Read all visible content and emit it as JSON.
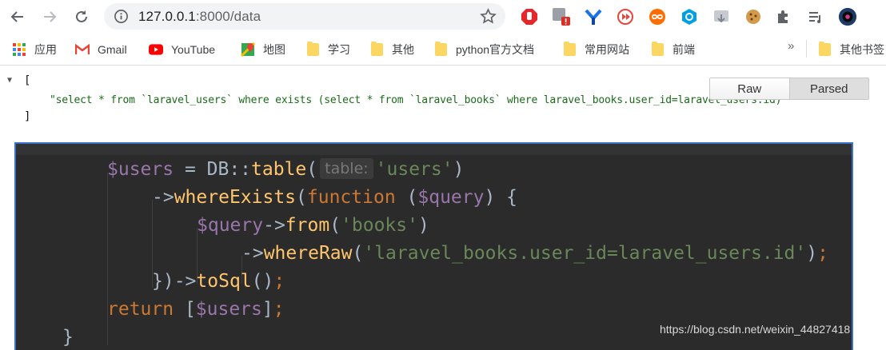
{
  "browser": {
    "url_host": "127.0.0.1",
    "url_rest": ":8000/data",
    "colors": {
      "omnibox_bg": "#f1f3f4",
      "icon": "#5f6368"
    }
  },
  "bookmarks": {
    "items": [
      {
        "label": "应用",
        "icon": "apps-grid-icon"
      },
      {
        "label": "Gmail",
        "icon": "gmail-icon"
      },
      {
        "label": "YouTube",
        "icon": "youtube-icon"
      },
      {
        "label": "地图",
        "icon": "maps-icon"
      },
      {
        "label": "学习",
        "icon": "folder-icon"
      },
      {
        "label": "其他",
        "icon": "folder-icon"
      },
      {
        "label": "python官方文档",
        "icon": "folder-icon"
      },
      {
        "label": "常用网站",
        "icon": "folder-icon"
      },
      {
        "label": "前端",
        "icon": "folder-icon"
      }
    ],
    "more": "»",
    "other": "其他书签"
  },
  "json_view": {
    "open_bracket": "[",
    "value": "\"select * from `laravel_users` where exists (select * from `laravel_books` where laravel_books.user_id=laravel_users.id)",
    "close_bracket": "]",
    "toggle": {
      "raw": "Raw",
      "parsed": "Parsed",
      "active": "Parsed"
    }
  },
  "code": {
    "line1": {
      "var": "$users",
      "eq": " = DB::",
      "fn": "table",
      "open": "(",
      "hint": "table:",
      "arg": "'users'",
      "close": ")"
    },
    "line2": {
      "arrow": "->",
      "fn": "whereExists",
      "open": "(",
      "kw": "function",
      "sp": " (",
      "var": "$query",
      "rest": ") {"
    },
    "line3": {
      "var": "$query",
      "arrow": "->",
      "fn": "from",
      "open": "(",
      "arg": "'books'",
      "close": ")"
    },
    "line4": {
      "arrow": "->",
      "fn": "whereRaw",
      "open": "(",
      "arg": "'laravel_books.user_id=laravel_users.id'",
      "close": ")",
      "semi": ";"
    },
    "line5": {
      "pre": "})",
      "arrow": "->",
      "fn": "toSql",
      "paren": "()",
      "semi": ";"
    },
    "line6": {
      "kw": "return",
      "sp": " [",
      "var": "$users",
      "close": "]",
      "semi": ";"
    },
    "line7": {
      "brace": "}"
    }
  },
  "watermark": "https://blog.csdn.net/weixin_44827418"
}
